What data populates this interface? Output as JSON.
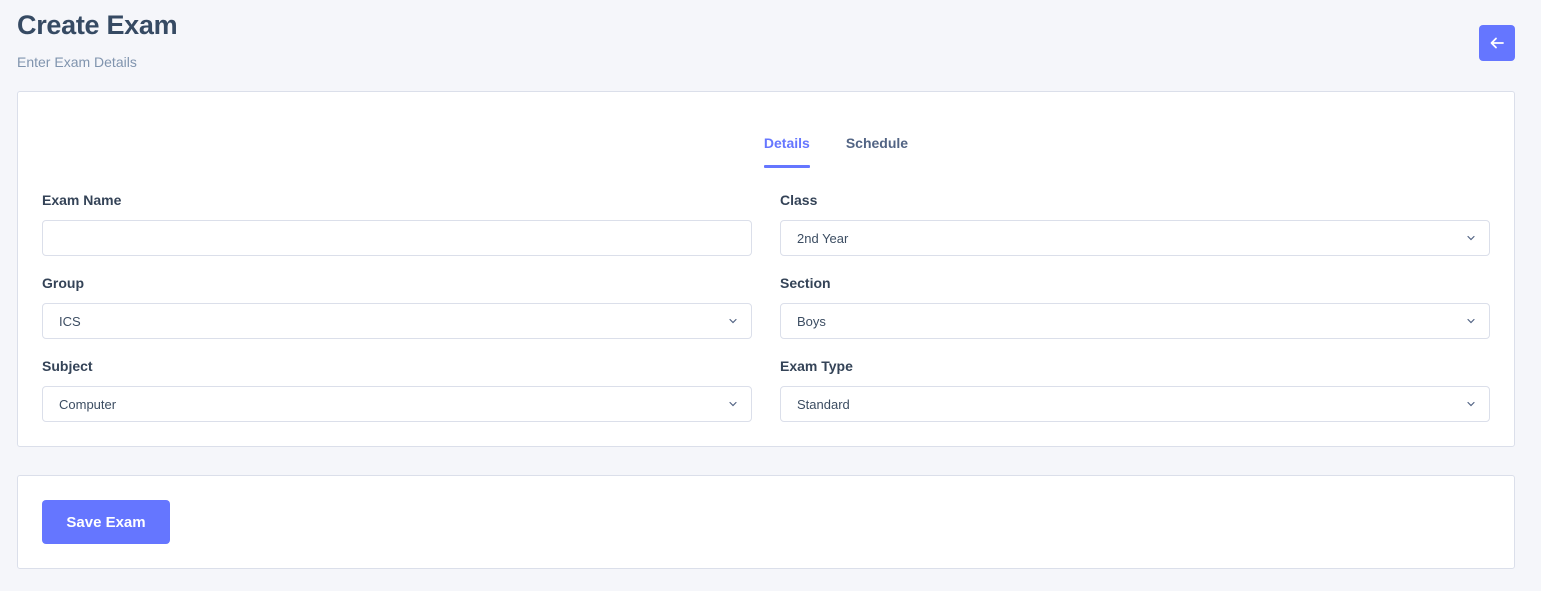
{
  "header": {
    "title": "Create Exam",
    "subtitle": "Enter Exam Details"
  },
  "back_button": {
    "icon": "arrow-left-icon"
  },
  "tabs": [
    {
      "label": "Details",
      "active": true
    },
    {
      "label": "Schedule",
      "active": false
    }
  ],
  "form": {
    "exam_name": {
      "label": "Exam Name",
      "value": "",
      "placeholder": ""
    },
    "class": {
      "label": "Class",
      "value": "2nd Year"
    },
    "group": {
      "label": "Group",
      "value": "ICS"
    },
    "section": {
      "label": "Section",
      "value": "Boys"
    },
    "subject": {
      "label": "Subject",
      "value": "Computer"
    },
    "exam_type": {
      "label": "Exam Type",
      "value": "Standard"
    }
  },
  "actions": {
    "save_label": "Save Exam"
  },
  "colors": {
    "accent": "#6576ff",
    "background": "#f5f6fa",
    "border": "#dbdfea",
    "heading": "#364a63",
    "muted": "#8094ae"
  }
}
